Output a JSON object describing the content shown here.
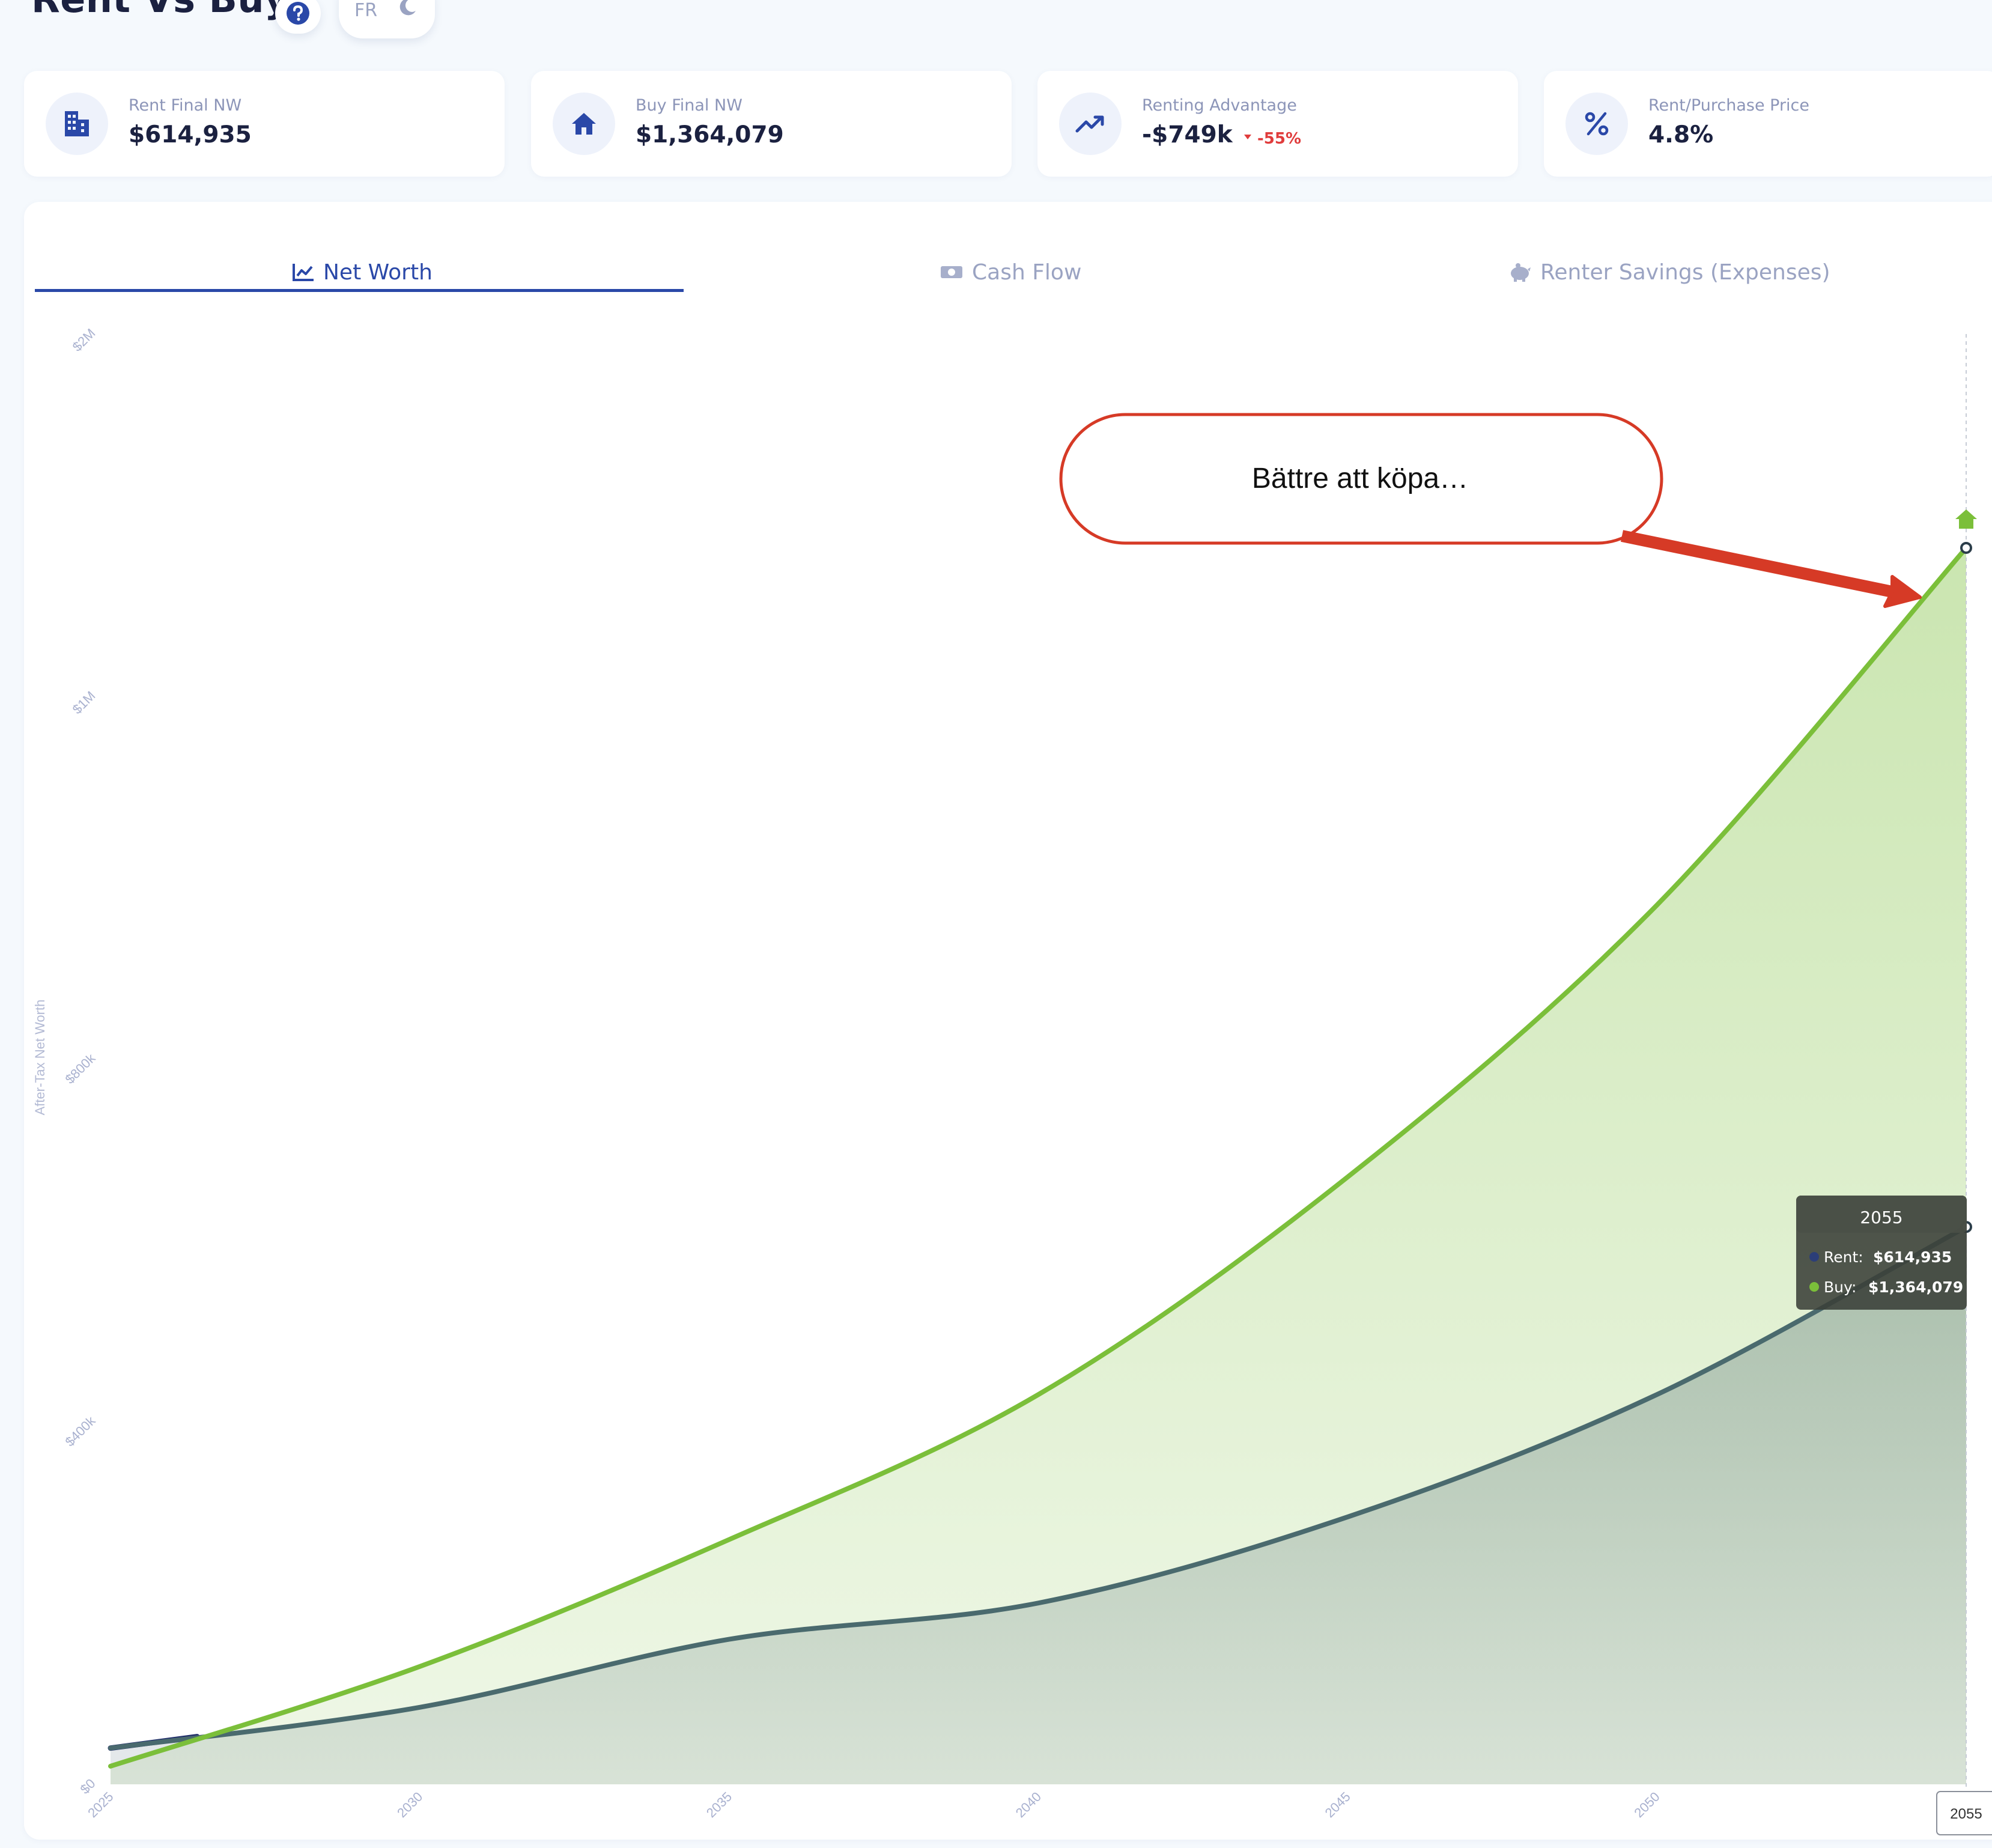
{
  "header": {
    "title": "Rent Vs Buy",
    "lang": "FR"
  },
  "summary_cards": [
    {
      "icon": "building-icon",
      "label": "Rent Final NW",
      "value": "$614,935"
    },
    {
      "icon": "home-icon",
      "label": "Buy Final NW",
      "value": "$1,364,079"
    },
    {
      "icon": "trending-up-icon",
      "label": "Renting Advantage",
      "value": "-$749k",
      "delta": "-55%"
    },
    {
      "icon": "percent-icon",
      "label": "Rent/Purchase Price",
      "value": "4.8%"
    }
  ],
  "tabs": [
    {
      "label": "Net Worth",
      "icon": "line-chart-icon",
      "active": true
    },
    {
      "label": "Cash Flow",
      "icon": "cash-icon",
      "active": false
    },
    {
      "label": "Renter Savings (Expenses)",
      "icon": "piggy-bank-icon",
      "active": false
    }
  ],
  "annotation": {
    "text": "Bättre att köpa…"
  },
  "tooltip": {
    "year": "2055",
    "rows": [
      {
        "label": "Rent:",
        "value": "$614,935",
        "color": "#2c3e78"
      },
      {
        "label": "Buy:",
        "value": "$1,364,079",
        "color": "#7bbf3a"
      }
    ]
  },
  "hover_year_label": "2055",
  "chart_data": {
    "type": "area",
    "ylabel": "After-Tax Net Worth",
    "x": [
      2025,
      2030,
      2035,
      2040,
      2045,
      2050,
      2055
    ],
    "x_ticks": [
      "2025",
      "2030",
      "2035",
      "2040",
      "2045",
      "2050"
    ],
    "y_ticks": [
      {
        "value": 0,
        "label": "$0"
      },
      {
        "value": 400000,
        "label": "$400k"
      },
      {
        "value": 800000,
        "label": "$800k"
      },
      {
        "value": 1200000,
        "label": "$1M"
      },
      {
        "value": 1600000,
        "label": "$2M"
      }
    ],
    "ylim": [
      0,
      1600000
    ],
    "grid": false,
    "series": [
      {
        "name": "Rent",
        "color": "#4a6a6e",
        "values": [
          40000,
          85000,
          160000,
          200000,
          295000,
          430000,
          614935
        ]
      },
      {
        "name": "Buy",
        "color": "#7bbf3a",
        "values": [
          20000,
          130000,
          270000,
          430000,
          670000,
          970000,
          1364079
        ]
      }
    ]
  }
}
